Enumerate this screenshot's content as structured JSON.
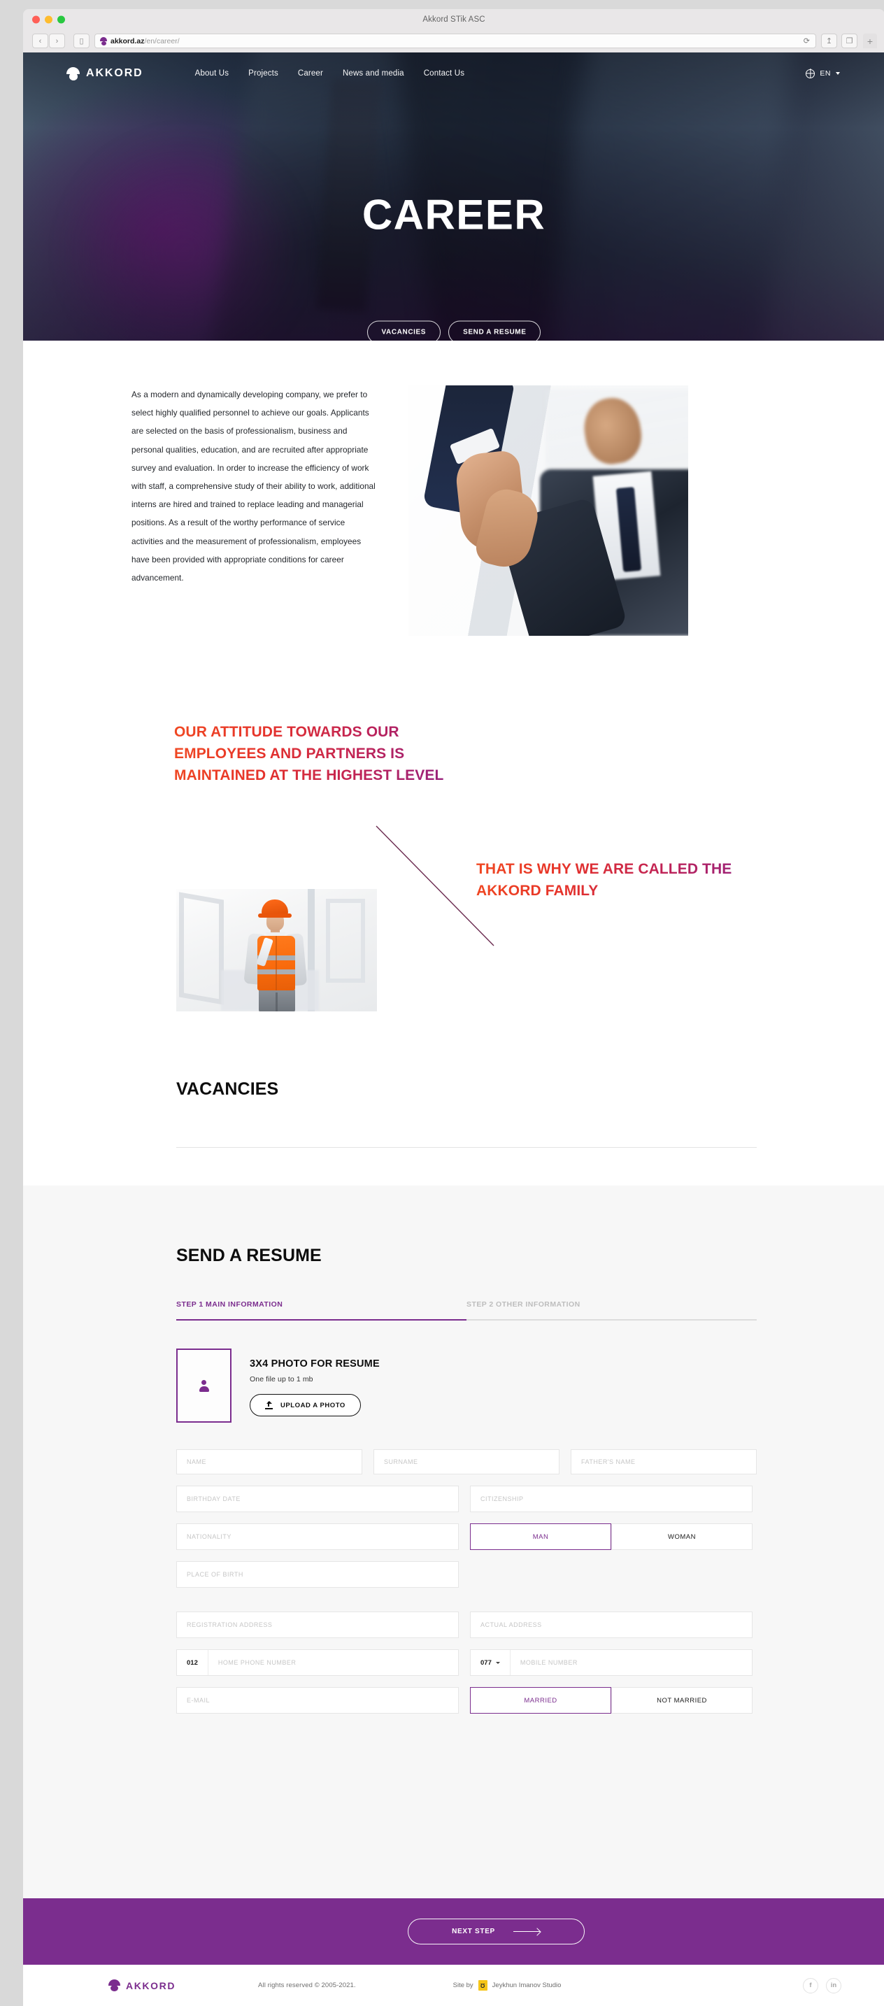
{
  "browser": {
    "window_title": "Akkord STik ASC",
    "url_domain": "akkord.az",
    "url_path": "/en/career/",
    "back_icon": "chevron-left-icon",
    "forward_icon": "chevron-right-icon",
    "sidebar_icon": "sidebar-icon",
    "reload_icon": "reload-icon",
    "share_icon": "share-icon",
    "tabs_icon": "tab-overview-icon",
    "new_tab_icon": "plus-icon"
  },
  "header": {
    "logo_text": "AKKORD",
    "nav": [
      {
        "label": "About Us"
      },
      {
        "label": "Projects"
      },
      {
        "label": "Career"
      },
      {
        "label": "News and media"
      },
      {
        "label": "Contact Us"
      }
    ],
    "lang": {
      "code": "EN",
      "globe_icon": "globe-icon",
      "caret_icon": "chevron-down-icon"
    }
  },
  "hero": {
    "title": "CAREER",
    "buttons": [
      {
        "label": "VACANCIES"
      },
      {
        "label": "SEND A RESUME"
      }
    ]
  },
  "intro": {
    "paragraph": "As a modern and dynamically developing company, we prefer to select highly qualified personnel to achieve our goals. Applicants are selected on the basis of professionalism, business and personal qualities, education, and are recruited after appropriate survey and evaluation. In order to increase the efficiency of work with staff, a comprehensive study of their ability to work, additional interns are hired and trained to replace leading and managerial positions. As a result of the worthy performance of service activities and the measurement of professionalism, employees have been provided with appropriate conditions for career advancement.",
    "image_alt": "handshake-photo"
  },
  "statements": {
    "attitude": "OUR ATTITUDE TOWARDS OUR EMPLOYEES AND PARTNERS IS MAINTAINED AT THE HIGHEST LEVEL",
    "family": "THAT IS WHY WE ARE CALLED THE AKKORD FAMILY",
    "worker_image_alt": "construction-worker-photo"
  },
  "vacancies": {
    "title": "VACANCIES"
  },
  "resume": {
    "title": "SEND A RESUME",
    "steps": [
      {
        "label": "STEP 1 MAIN INFORMATION",
        "active": true
      },
      {
        "label": "STEP 2 OTHER INFORMATION",
        "active": false
      }
    ],
    "photo": {
      "title": "3X4 PHOTO FOR RESUME",
      "subtitle": "One file up to 1 mb",
      "upload_label": "UPLOAD A PHOTO",
      "placeholder_icon": "person-icon",
      "upload_icon": "upload-icon"
    },
    "fields": {
      "name": "NAME",
      "surname": "SURNAME",
      "fathers_name": "FATHER'S NAME",
      "birthday_date": "BIRTHDAY DATE",
      "citizenship": "CITIZENSHIP",
      "nationality": "NATIONALITY",
      "place_of_birth": "PLACE OF BIRTH",
      "registration_address": "REGISTRATION ADDRESS",
      "actual_address": "ACTUAL ADDRESS",
      "home_phone": "HOME PHONE NUMBER",
      "mobile_number": "MOBILE NUMBER",
      "email": "E-MAIL"
    },
    "gender": {
      "man": "MAN",
      "woman": "WOMAN",
      "selected": "MAN"
    },
    "marital": {
      "married": "MARRIED",
      "not_married": "NOT MARRIED",
      "selected": "MARRIED"
    },
    "phone_prefixes": {
      "home": "012",
      "mobile": "077"
    },
    "next_step": {
      "label": "NEXT STEP",
      "arrow_icon": "arrow-right-icon"
    }
  },
  "footer": {
    "logo_text": "AKKORD",
    "copyright": "All rights reserved © 2005-2021.",
    "site_by_prefix": "Site by",
    "site_by_badge": "Ʊ",
    "site_by_name": "Jeykhun Imanov Studio",
    "social": [
      {
        "glyph": "f",
        "name": "facebook-icon"
      },
      {
        "glyph": "in",
        "name": "linkedin-icon"
      }
    ]
  },
  "colors": {
    "brand_purple": "#7b2d8e",
    "accent_red": "#e6332a",
    "accent_orange": "#f04822"
  }
}
